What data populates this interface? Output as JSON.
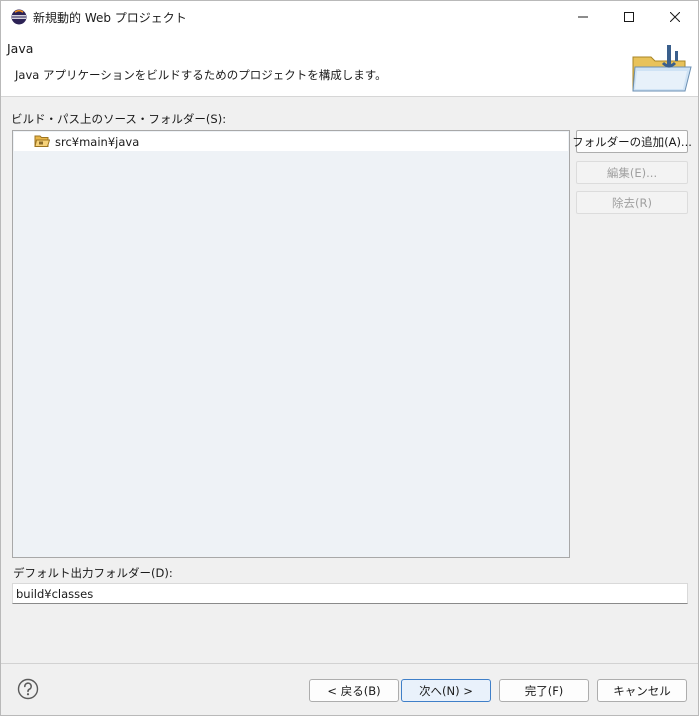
{
  "window": {
    "title": "新規動的 Web プロジェクト"
  },
  "banner": {
    "title": "Java",
    "description": "Java アプリケーションをビルドするためのプロジェクトを構成します。"
  },
  "source_folders": {
    "label": "ビルド・パス上のソース・フォルダー(S):",
    "items": [
      {
        "label": "src¥main¥java",
        "icon": "source-folder-icon"
      }
    ]
  },
  "side_buttons": {
    "add_folder": "フォルダーの追加(A)...",
    "edit": "編集(E)...",
    "remove": "除去(R)"
  },
  "output_folder": {
    "label": "デフォルト出力フォルダー(D):",
    "value": "build¥classes"
  },
  "footer": {
    "back": "< 戻る(B)",
    "next": "次へ(N) >",
    "finish": "完了(F)",
    "cancel": "キャンセル"
  },
  "colors": {
    "accent": "#3f7fc8",
    "list_background": "#eef2f6",
    "window_background": "#f0f0f0"
  }
}
